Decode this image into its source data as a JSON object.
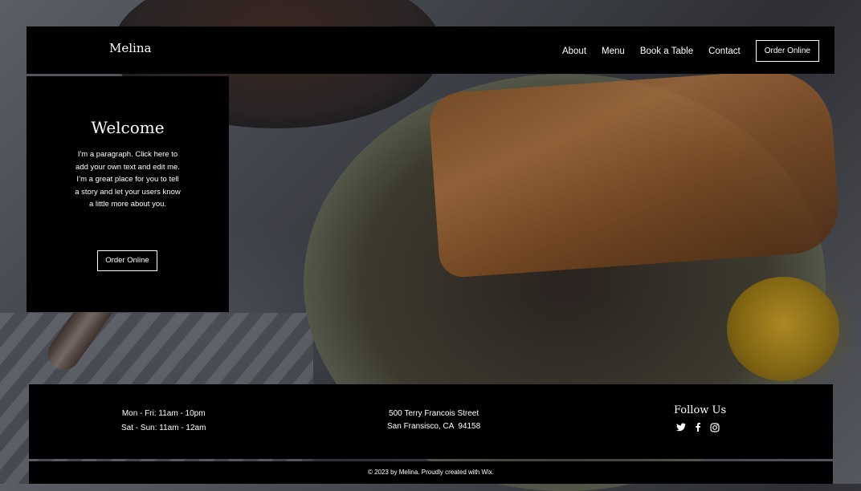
{
  "header": {
    "brand": "Melina",
    "nav": [
      {
        "label": "About"
      },
      {
        "label": "Menu"
      },
      {
        "label": "Book a Table"
      },
      {
        "label": "Contact"
      }
    ],
    "order_button": "Order Online"
  },
  "welcome": {
    "title": "Welcome",
    "paragraph": "I'm a paragraph. Click here to add your own text and edit me. I’m a great place for you to tell a story and let your users know a little more about you.",
    "order_button": "Order Online"
  },
  "footer": {
    "hours": [
      "Mon - Fri: 11am - 10pm",
      "Sat - Sun: 11am - 12am"
    ],
    "address": [
      "500 Terry Francois Street",
      "San Fransisco, CA  94158"
    ],
    "follow_title": "Follow Us",
    "socials": [
      "twitter-icon",
      "facebook-icon",
      "instagram-icon"
    ],
    "copyright": "© 2023 by Melina. Proudly created with Wix."
  }
}
